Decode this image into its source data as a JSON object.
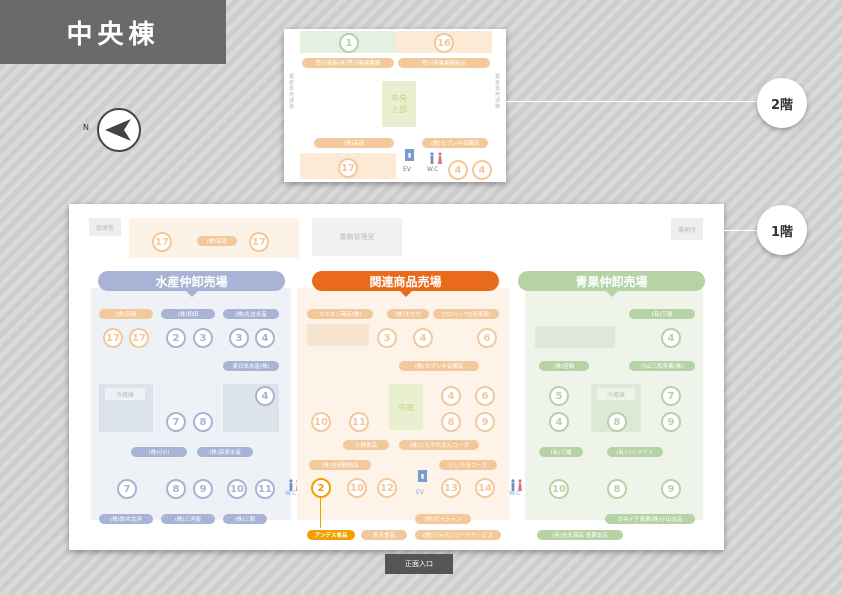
{
  "title": "中央棟",
  "compass": {
    "label": "N"
  },
  "floor2": {
    "label": "2階",
    "numbers": [
      "1",
      "16",
      "17",
      "4",
      "4"
    ],
    "tags": [
      "荒川商事(株)荒川業務書籍",
      "荒川青果業務組合",
      "(株)高原",
      "(株)セブンネ名購店"
    ],
    "center_label": "中央\n上部",
    "vertical_left": "業者専用通路",
    "vertical_right": "業者専用通路",
    "ev": "EV",
    "wc": "W.C"
  },
  "floor1": {
    "label": "1階",
    "entrance": "正面入口",
    "top_labels": [
      "倉庫室",
      "業務管理室",
      "事務所"
    ],
    "top_tag": "(株)高原",
    "top_numbers": [
      "17",
      "17"
    ],
    "sections": {
      "fish": {
        "name": "水産仲卸売場",
        "tags": [
          "(株)高岡",
          "(株)和田",
          "(株)丸吉水産",
          "東日本水産(株)",
          "(株)小川",
          "(株)荻原水産",
          "(株)鈴木北洋",
          "(株)三河屋",
          "(株)三和"
        ],
        "numbers": [
          "17",
          "17",
          "2",
          "3",
          "3",
          "4",
          "4",
          "7",
          "8",
          "7",
          "8",
          "9",
          "10",
          "11"
        ],
        "cold_label": "冷蔵庫"
      },
      "related": {
        "name": "関連商品売場",
        "tags": [
          "マルスン商店(株)",
          "(株)すかや",
          "クロバックJ(青果部)",
          "(株)セブンネ名購店",
          "小野食品",
          "(株)ともやれなんコープ",
          "(株)吉田精肉店",
          "いしやまフーズ",
          "(株)ボイシャン",
          "(株)ジャパンフードサービス",
          "青木食品"
        ],
        "numbers": [
          "3",
          "4",
          "6",
          "4",
          "6",
          "10",
          "11",
          "8",
          "9",
          "2",
          "10",
          "12",
          "13",
          "14"
        ],
        "center_label": "中庭",
        "highlight_tag": "アンデス食品",
        "highlight_number": "2"
      },
      "produce": {
        "name": "青果仲卸売場",
        "tags": [
          "(有)三陽",
          "(株)宮崎",
          "小山三和青果(株)",
          "(有)三橋",
          "(有)ベジメイト",
          "カネイチ青果(株)小山支店",
          "(有)丸久商店 青果支店"
        ],
        "numbers": [
          "4",
          "5",
          "7",
          "4",
          "8",
          "9",
          "10",
          "8",
          "9"
        ],
        "cold_label": "冷蔵庫"
      }
    },
    "ev": "EV",
    "wc": "W.C"
  },
  "colors": {
    "fish": "#7d80b8",
    "related": "#e86a1a",
    "produce": "#8ba87c",
    "highlight": "#f0a000",
    "faded_orange": "#f3c89a",
    "faded_green": "#b6d3a6",
    "faded_blue": "#a9b3d6",
    "faded_gray": "#b0b0b0"
  }
}
